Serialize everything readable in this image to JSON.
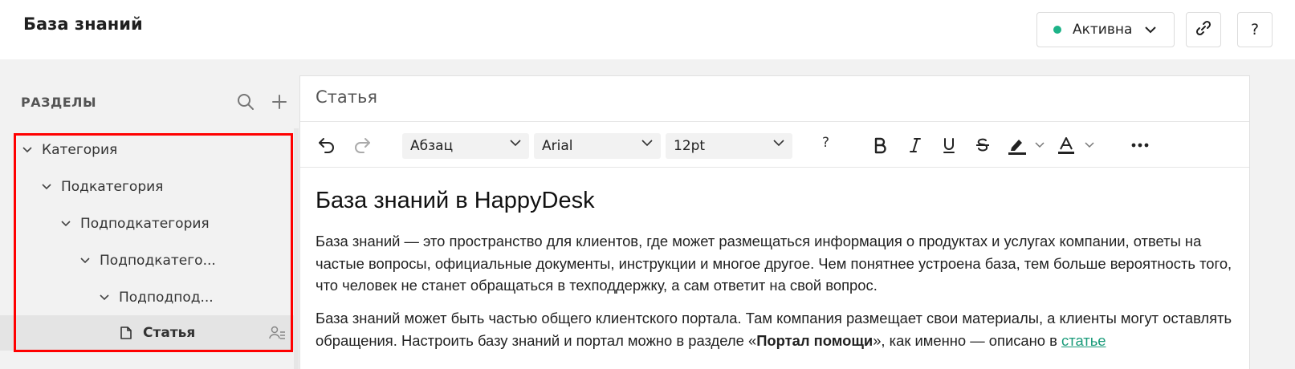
{
  "header": {
    "title": "База знаний",
    "status_label": "Активна",
    "status_color": "#1db388",
    "link_icon": "link-icon",
    "help_label": "?"
  },
  "sidebar": {
    "sections_title": "РАЗДЕЛЫ",
    "search_icon": "search-icon",
    "add_icon": "plus-icon",
    "tree": [
      {
        "label": "Категория"
      },
      {
        "label": "Подкатегория"
      },
      {
        "label": "Подподкатегория"
      },
      {
        "label": "Подподкатего..."
      },
      {
        "label": "Подподпод..."
      },
      {
        "label": "Статья",
        "selected": true
      }
    ],
    "highlight_color": "#ff0000"
  },
  "editor": {
    "title": "Статья",
    "toolbar": {
      "block_format": "Абзац",
      "font_family": "Arial",
      "font_size": "12pt",
      "help": "?"
    },
    "heading": "База знаний в HappyDesk",
    "paragraph1": "База знаний — это пространство для клиентов, где может размещаться информация о продуктах и услугах компании, ответы на частые вопросы, официальные документы, инструкции и многое другое. Чем понятнее устроена база, тем больше вероятность того, что человек не станет обращаться в техподдержку, а сам ответит на свой вопрос.",
    "paragraph2_part1": "База знаний может быть частью общего клиентского портала. Там компания размещает свои материалы, а клиенты могут оставлять обращения. Настроить базу знаний и портал можно в разделе «",
    "paragraph2_bold": "Портал помощи",
    "paragraph2_part2": "», как именно — описано в ",
    "paragraph2_link": "статье",
    "link_color": "#1a9b7a"
  }
}
